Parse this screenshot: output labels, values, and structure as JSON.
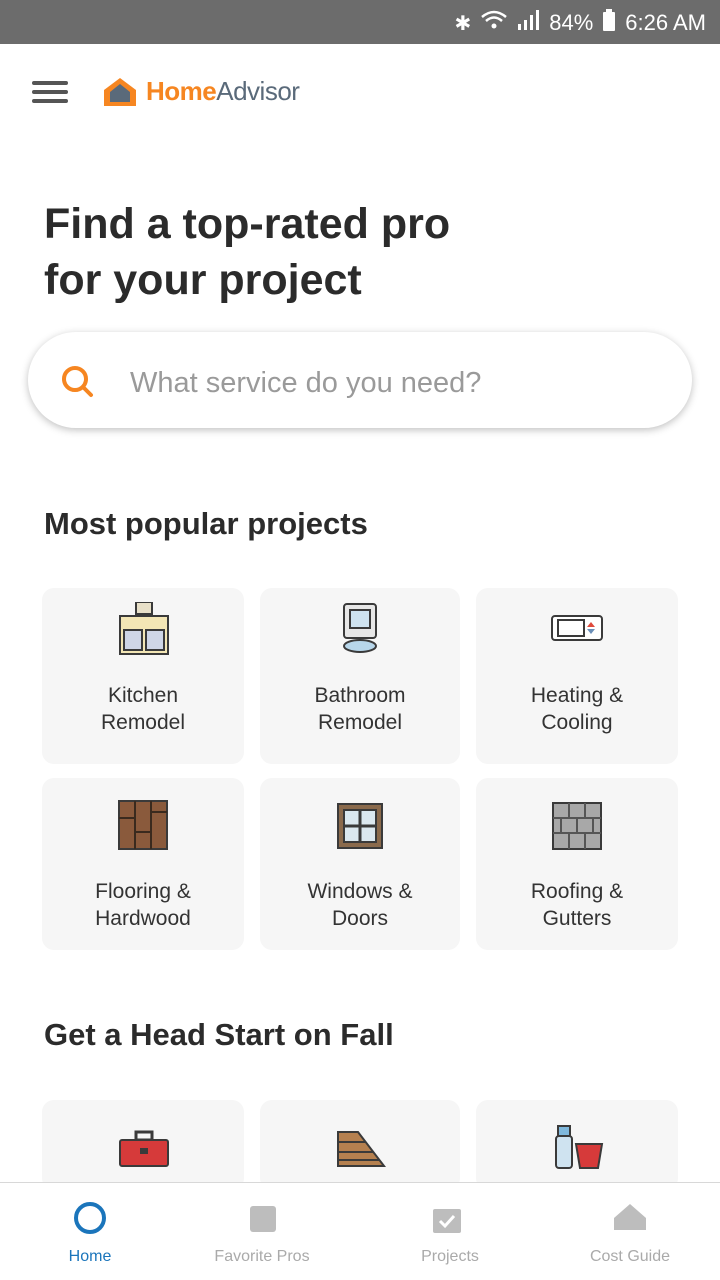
{
  "status_bar": {
    "battery": "84%",
    "time": "6:26 AM"
  },
  "header": {
    "logo_home": "Home",
    "logo_advisor": "Advisor"
  },
  "hero": {
    "title_line1": "Find a top-rated pro",
    "title_line2": "for your project"
  },
  "search": {
    "placeholder": "What service do you need?"
  },
  "popular": {
    "title": "Most popular projects",
    "tiles": [
      {
        "line1": "Kitchen",
        "line2": "Remodel",
        "icon": "kitchen-icon"
      },
      {
        "line1": "Bathroom",
        "line2": "Remodel",
        "icon": "bathroom-icon"
      },
      {
        "line1": "Heating &",
        "line2": "Cooling",
        "icon": "thermostat-icon"
      },
      {
        "line1": "Flooring &",
        "line2": "Hardwood",
        "icon": "flooring-icon"
      },
      {
        "line1": "Windows &",
        "line2": "Doors",
        "icon": "window-icon"
      },
      {
        "line1": "Roofing &",
        "line2": "Gutters",
        "icon": "roofing-icon"
      }
    ]
  },
  "fall": {
    "title": "Get a Head Start on Fall"
  },
  "bottom_nav": {
    "items": [
      {
        "label": "Home",
        "icon": "home-icon",
        "active": true
      },
      {
        "label": "Favorite Pros",
        "icon": "favorite-icon",
        "active": false
      },
      {
        "label": "Projects",
        "icon": "projects-icon",
        "active": false
      },
      {
        "label": "Cost Guide",
        "icon": "cost-guide-icon",
        "active": false
      }
    ]
  },
  "colors": {
    "brand_orange": "#f68621",
    "active_blue": "#1b75bb"
  }
}
